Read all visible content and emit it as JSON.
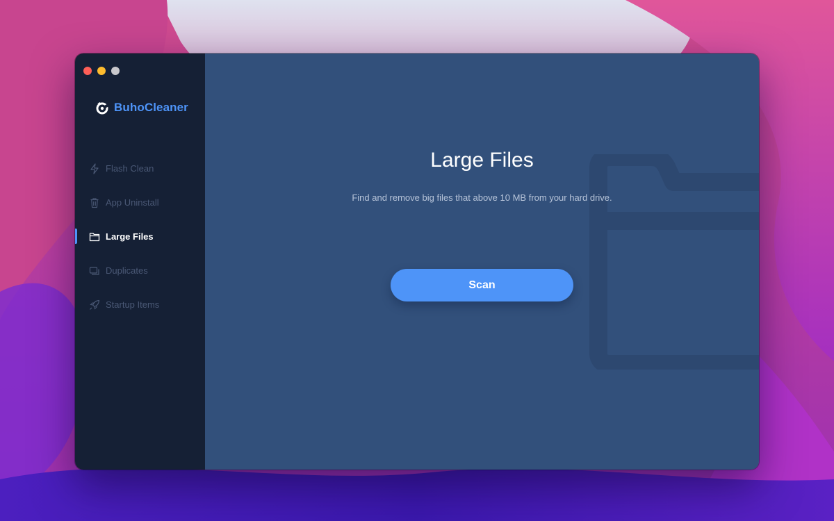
{
  "app": {
    "name": "BuhoCleaner",
    "brand_color": "#4e94f8",
    "logo_icon": "buho-logo-icon"
  },
  "window_controls": {
    "close_color": "#fe5f57",
    "minimize_color": "#febc2e",
    "zoom_color": "#c8c8cc"
  },
  "sidebar": {
    "items": [
      {
        "label": "Flash Clean",
        "icon": "lightning-icon",
        "active": false
      },
      {
        "label": "App Uninstall",
        "icon": "trash-icon",
        "active": false
      },
      {
        "label": "Large Files",
        "icon": "folder-icon",
        "active": true
      },
      {
        "label": "Duplicates",
        "icon": "duplicates-icon",
        "active": false
      },
      {
        "label": "Startup Items",
        "icon": "rocket-icon",
        "active": false
      }
    ]
  },
  "main": {
    "title": "Large Files",
    "subtitle": "Find and remove big files that above 10 MB from your hard drive.",
    "scan_label": "Scan",
    "background_icon": "folder-icon"
  },
  "colors": {
    "sidebar_bg": "#152035",
    "main_bg": "#32507b",
    "accent": "#4e94f8"
  }
}
